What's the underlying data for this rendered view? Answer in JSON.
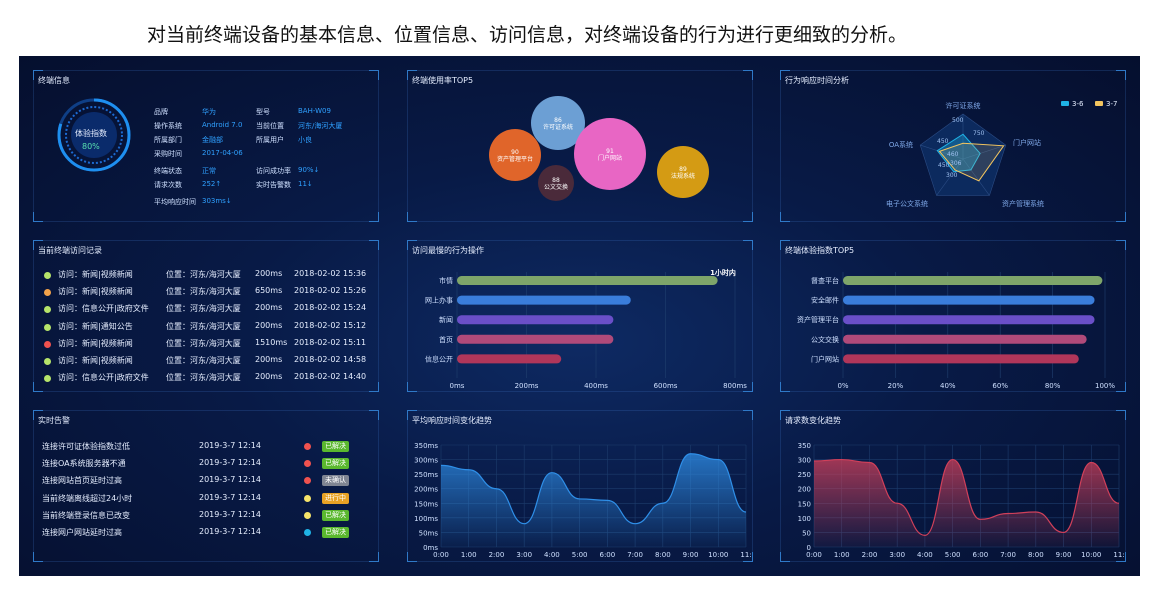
{
  "caption": "对当前终端设备的基本信息、位置信息、访问信息，对终端设备的行为进行更细致的分析。",
  "colors": {
    "background": "#081a46",
    "accent": "#2fa0ff",
    "panel_border": "#2f79c8"
  },
  "terminal_info": {
    "title": "终端信息",
    "gauge_label": "体验指数",
    "gauge_value": "80%",
    "fields": [
      {
        "label": "品牌",
        "value": "华为"
      },
      {
        "label": "型号",
        "value": "BAH-W09"
      },
      {
        "label": "操作系统",
        "value": "Android 7.0"
      },
      {
        "label": "当前位置",
        "value": "河东/海河大厦"
      },
      {
        "label": "所属部门",
        "value": "金融部"
      },
      {
        "label": "所属用户",
        "value": "小良"
      },
      {
        "label": "采购时间",
        "value": "2017-04-06"
      },
      {
        "label": "终端状态",
        "value": "正常"
      },
      {
        "label": "访问成功率",
        "value": "90%↓"
      },
      {
        "label": "请求次数",
        "value": "252↑"
      },
      {
        "label": "实时告警数",
        "value": "11↓"
      },
      {
        "label": "平均响应时间",
        "value": "303ms↓"
      }
    ]
  },
  "usage_top5": {
    "title": "终端使用率TOP5",
    "bubbles": [
      {
        "value": "86",
        "name": "许可证系统",
        "color": "#6c9fd4"
      },
      {
        "value": "91",
        "name": "门户网站",
        "color": "#e866c4"
      },
      {
        "value": "90",
        "name": "资产管理平台",
        "color": "#e0652a"
      },
      {
        "value": "88",
        "name": "公文交换",
        "color": "#4a2a3a"
      },
      {
        "value": "89",
        "name": "法规系统",
        "color": "#d49b14"
      }
    ]
  },
  "response_analysis": {
    "title": "行为响应时间分析",
    "legend": [
      {
        "name": "3-6",
        "color": "#1fb3e6"
      },
      {
        "name": "3-7",
        "color": "#f3c55f"
      }
    ],
    "axes": [
      "许可证系统",
      "门户网站",
      "资产管理系统",
      "电子公文系统",
      "OA系统"
    ],
    "tick_labels": [
      "500",
      "750",
      "450",
      "460",
      "306",
      "450",
      "300"
    ]
  },
  "visit_records": {
    "title": "当前终端访问记录",
    "rows": [
      {
        "dot": "#b6e46a",
        "visit": "访问：新闻|视频新闻",
        "loc": "位置：河东/海河大厦",
        "ms": "200ms",
        "time": "2018-02-02 15:36"
      },
      {
        "dot": "#f2a24a",
        "visit": "访问：新闻|视频新闻",
        "loc": "位置：河东/海河大厦",
        "ms": "650ms",
        "time": "2018-02-02 15:26"
      },
      {
        "dot": "#b6e46a",
        "visit": "访问：信息公开|政府文件",
        "loc": "位置：河东/海河大厦",
        "ms": "200ms",
        "time": "2018-02-02 15:24"
      },
      {
        "dot": "#b6e46a",
        "visit": "访问：新闻|通知公告",
        "loc": "位置：河东/海河大厦",
        "ms": "200ms",
        "time": "2018-02-02 15:12"
      },
      {
        "dot": "#f0524f",
        "visit": "访问：新闻|视频新闻",
        "loc": "位置：河东/海河大厦",
        "ms": "1510ms",
        "time": "2018-02-02 15:11"
      },
      {
        "dot": "#b6e46a",
        "visit": "访问：新闻|视频新闻",
        "loc": "位置：河东/海河大厦",
        "ms": "200ms",
        "time": "2018-02-02 14:58"
      },
      {
        "dot": "#b6e46a",
        "visit": "访问：信息公开|政府文件",
        "loc": "位置：河东/海河大厦",
        "ms": "200ms",
        "time": "2018-02-02 14:40"
      }
    ]
  },
  "alerts": {
    "title": "实时告警",
    "rows": [
      {
        "text": "连接许可证体验指数过低",
        "time": "2019-3-7 12:14",
        "dot": "#f0524f",
        "status": "已解决",
        "status_color": "#5ab82e"
      },
      {
        "text": "连接OA系统服务器不通",
        "time": "2019-3-7 12:14",
        "dot": "#f0524f",
        "status": "已解决",
        "status_color": "#5ab82e"
      },
      {
        "text": "连接网站首页延时过高",
        "time": "2019-3-7 12:14",
        "dot": "#f0524f",
        "status": "未确认",
        "status_color": "#7f8592"
      },
      {
        "text": "当前终端离线超过24小时",
        "time": "2019-3-7 12:14",
        "dot": "#f6e36a",
        "status": "进行中",
        "status_color": "#e8a224"
      },
      {
        "text": "当前终端登录信息已改变",
        "time": "2019-3-7 12:14",
        "dot": "#f6e36a",
        "status": "已解决",
        "status_color": "#5ab82e"
      },
      {
        "text": "连接网户网站延时过高",
        "time": "2019-3-7 12:14",
        "dot": "#1fb3e6",
        "status": "已解决",
        "status_color": "#5ab82e"
      }
    ]
  },
  "chart_data": [
    {
      "type": "bar",
      "title": "访问最慢的行为操作",
      "categories": [
        "市情",
        "网上办事",
        "新闻",
        "首页",
        "信息公开"
      ],
      "values": [
        750,
        500,
        450,
        450,
        300
      ],
      "colors": [
        "#7ea56a",
        "#3a7ddb",
        "#6a4fc8",
        "#b04a7a",
        "#b0365a"
      ],
      "annotation": "1小时内",
      "xticks": [
        "0ms",
        "200ms",
        "400ms",
        "600ms",
        "800ms"
      ],
      "xlim": [
        0,
        800
      ]
    },
    {
      "type": "bar",
      "title": "终端体验指数TOP5",
      "categories": [
        "督查平台",
        "安全邮件",
        "资产管理平台",
        "公文交换",
        "门户网站"
      ],
      "values": [
        99,
        96,
        96,
        93,
        90
      ],
      "colors": [
        "#7ea56a",
        "#3a7ddb",
        "#6a4fc8",
        "#b04a7a",
        "#b0365a"
      ],
      "xticks": [
        "0%",
        "20%",
        "40%",
        "60%",
        "80%",
        "100%"
      ],
      "xlim": [
        0,
        100
      ]
    },
    {
      "type": "area",
      "title": "平均响应时间变化趋势",
      "x": [
        "0:00",
        "1:00",
        "2:00",
        "3:00",
        "4:00",
        "5:00",
        "6:00",
        "7:00",
        "8:00",
        "9:00",
        "10:00",
        "11:"
      ],
      "values": [
        280,
        265,
        200,
        80,
        255,
        165,
        160,
        80,
        150,
        320,
        300,
        120
      ],
      "yticks": [
        "0ms",
        "50ms",
        "100ms",
        "150ms",
        "200ms",
        "250ms",
        "300ms",
        "350ms"
      ],
      "ylim": [
        0,
        350
      ],
      "color": "#2f8fe8"
    },
    {
      "type": "area",
      "title": "请求数变化趋势",
      "x": [
        "0:00",
        "1:00",
        "2:00",
        "3:00",
        "4:00",
        "5:00",
        "6:00",
        "7:00",
        "8:00",
        "9:00",
        "10:00",
        "11:"
      ],
      "values": [
        295,
        300,
        290,
        150,
        40,
        300,
        95,
        115,
        120,
        50,
        290,
        150
      ],
      "yticks": [
        "0",
        "50",
        "100",
        "150",
        "200",
        "250",
        "300",
        "350"
      ],
      "ylim": [
        0,
        350
      ],
      "color": "#d0405a"
    }
  ]
}
